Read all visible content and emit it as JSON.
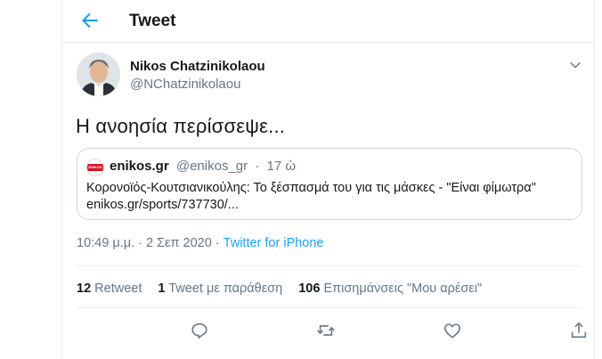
{
  "header": {
    "title": "Tweet",
    "back_icon": "arrow-left-icon"
  },
  "tweet": {
    "author": {
      "name": "Nikos Chatzinikolaou",
      "handle": "@NChatzinikolaou"
    },
    "text": "Η ανοησία περίσσεψε...",
    "quote": {
      "name": "enikos.gr",
      "handle": "@enikos_gr",
      "separator": "·",
      "age": "17 ώ",
      "logo_text": "ENIKOS",
      "body_line1": "Κορονοϊός-Κουτσιανικούλης: Το ξέσπασμά του για τις μάσκες - \"Είναι φίμωτρα\"",
      "body_line2": "enikos.gr/sports/737730/..."
    },
    "timestamp": "10:49 μ.μ. · 2 Σεπ 2020 · ",
    "source": "Twitter for iPhone"
  },
  "stats": {
    "retweets_count": "12",
    "retweets_label": "Retweet",
    "quotes_count": "1",
    "quotes_label": "Tweet με παράθεση",
    "likes_count": "106",
    "likes_label": "Επισημάνσεις \"Μου αρέσει\""
  },
  "colors": {
    "accent": "#1da1f2",
    "secondary_text": "#657786",
    "border": "#e6ecf0"
  }
}
